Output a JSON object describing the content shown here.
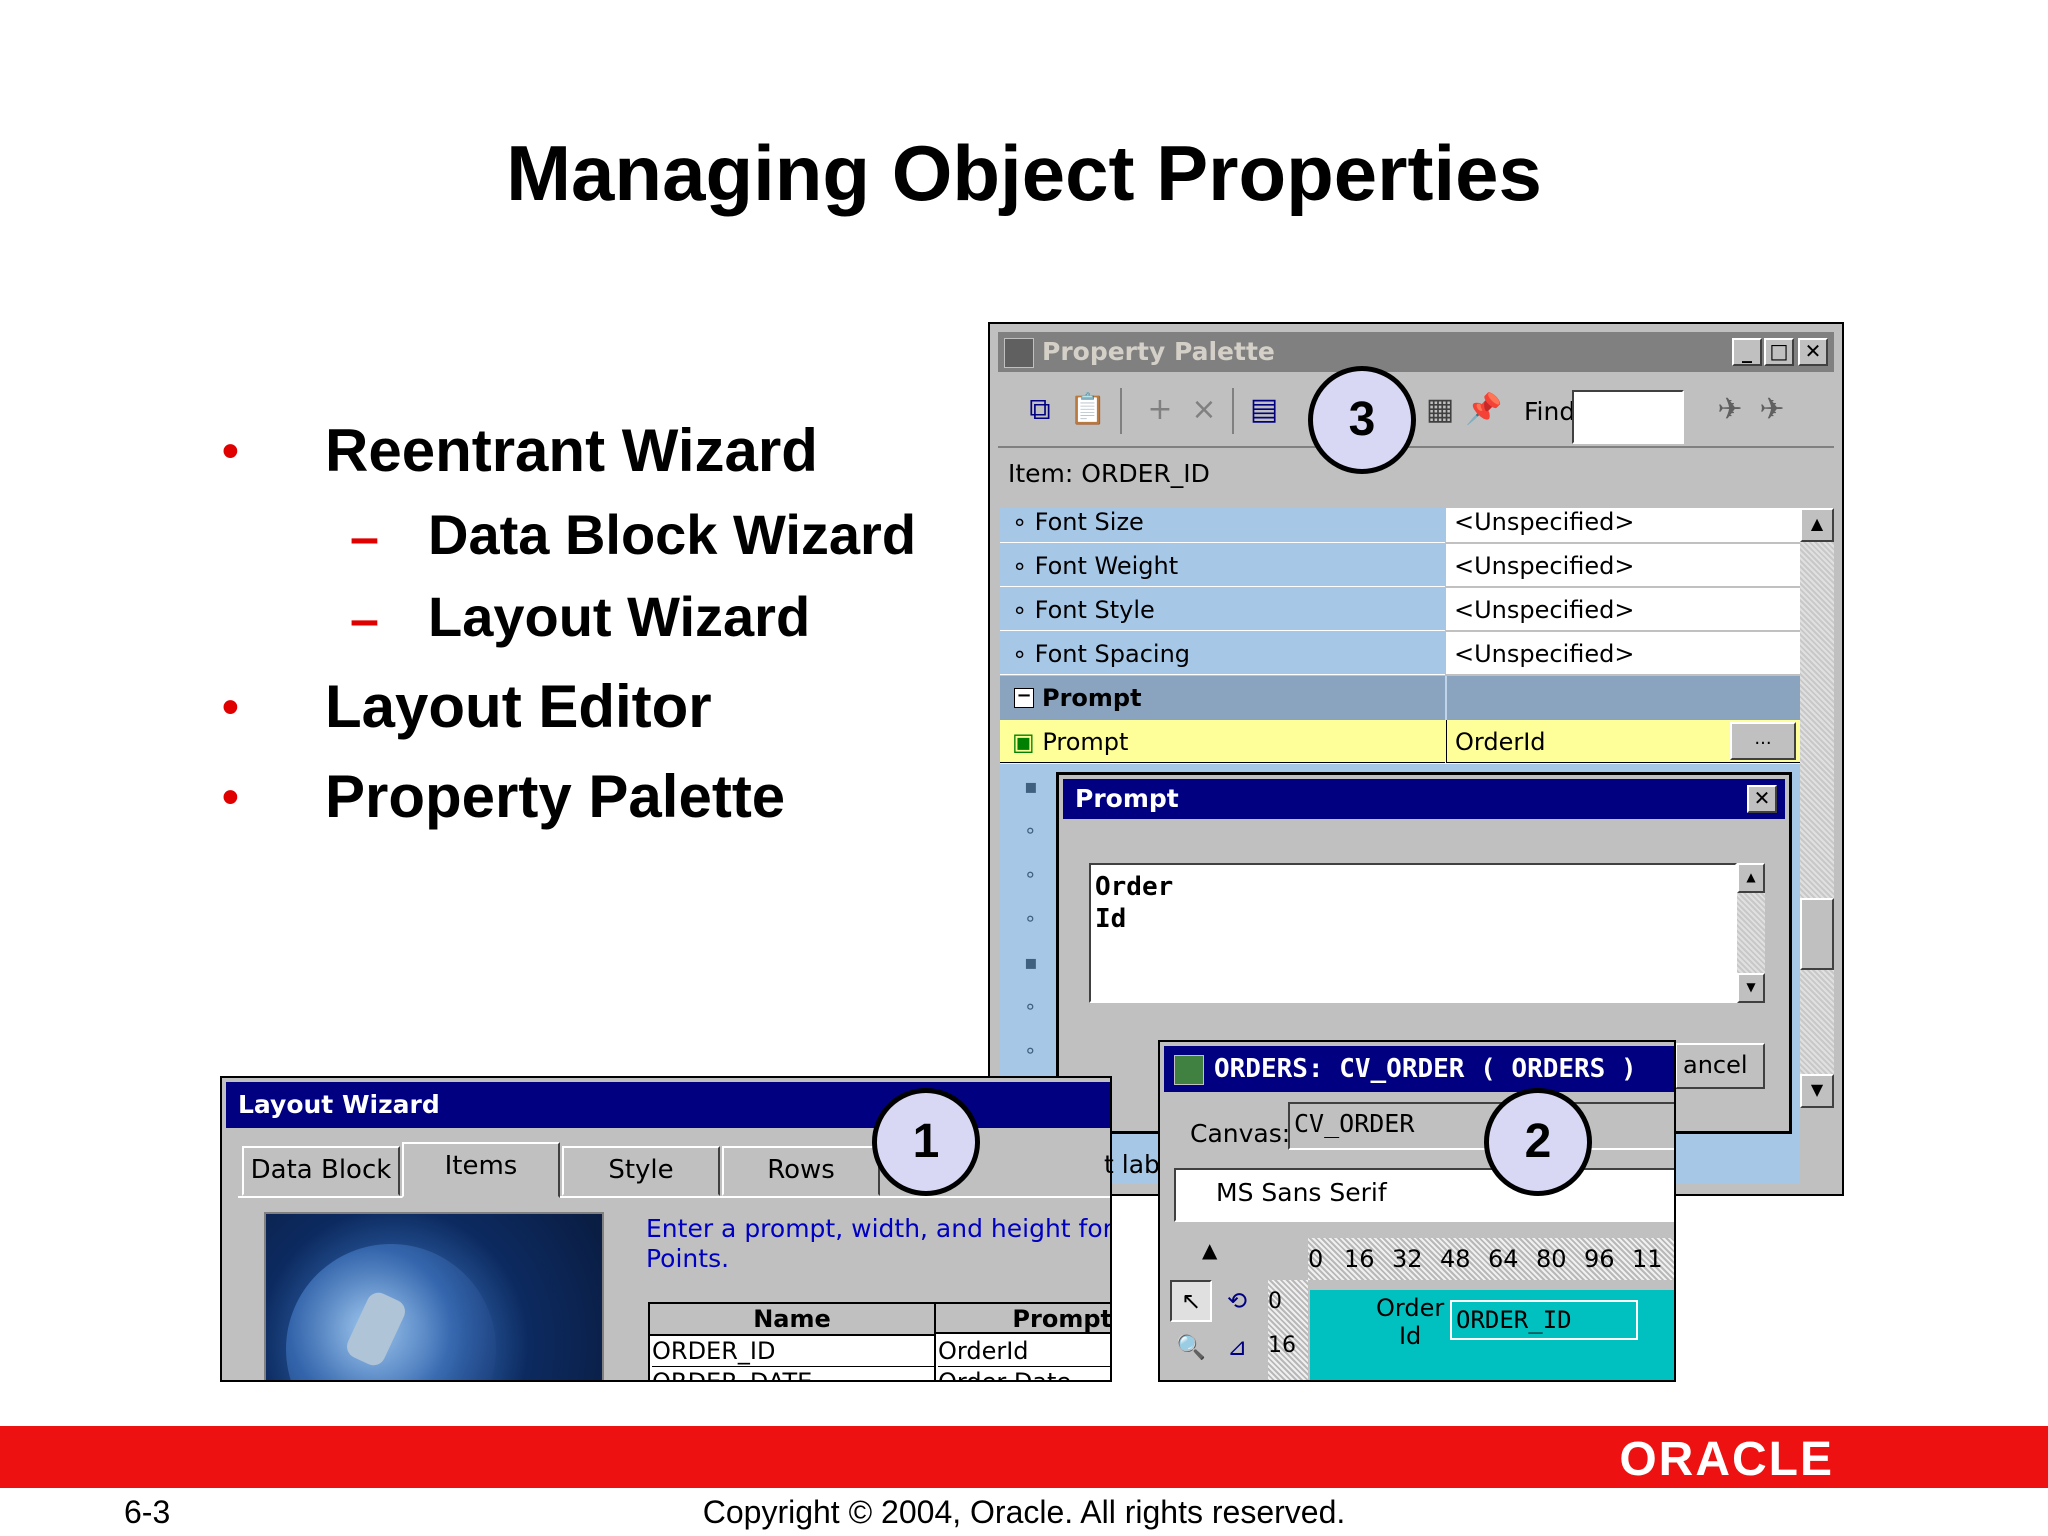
{
  "slide": {
    "title": "Managing Object Properties",
    "bullets": [
      {
        "text": "Reentrant Wizard",
        "level": 1
      },
      {
        "text": "Data Block Wizard",
        "level": 2
      },
      {
        "text": "Layout Wizard",
        "level": 2
      },
      {
        "text": "Layout Editor",
        "level": 1
      },
      {
        "text": "Property Palette",
        "level": 1
      }
    ],
    "bullet_marker": "•",
    "dash_marker": "–",
    "callouts": [
      "1",
      "2",
      "3"
    ],
    "logo": "ORACLE",
    "page_number": "6-3",
    "copyright": "Copyright © 2004, Oracle.  All rights reserved.",
    "colors": {
      "red": "#ee1111",
      "callout_fill": "#d8d8f4",
      "highlight": "#ffff99",
      "prop_blue": "#a7c7e7"
    }
  },
  "property_palette": {
    "title": "Property Palette",
    "find_label": "Find:",
    "item_label": "Item: ORDER_ID",
    "rows": [
      {
        "name": "Font Size",
        "value": "<Unspecified>"
      },
      {
        "name": "Font Weight",
        "value": "<Unspecified>"
      },
      {
        "name": "Font Style",
        "value": "<Unspecified>"
      },
      {
        "name": "Font Spacing",
        "value": "<Unspecified>"
      }
    ],
    "group": "Prompt",
    "selected_row": {
      "name": "Prompt",
      "value": "OrderId",
      "more": "..."
    }
  },
  "prompt_dialog": {
    "title": "Prompt",
    "text_line1": "Order",
    "text_line2": "Id",
    "cancel_partial": "ancel"
  },
  "layout_editor": {
    "title": "ORDERS: CV_ORDER ( ORDERS )",
    "canvas_label": "Canvas:",
    "canvas_value": "CV_ORDER",
    "font_value": "MS Sans Serif",
    "ruler": [
      "0",
      "16",
      "32",
      "48",
      "64",
      "80",
      "96",
      "11"
    ],
    "vruler": [
      "0",
      "16"
    ],
    "prompt_line1": "Order",
    "prompt_line2": "Id",
    "item_text": "ORDER_ID",
    "partial_text": "t lab"
  },
  "layout_wizard": {
    "title": "Layout Wizard",
    "tabs": [
      "Data Block",
      "Items",
      "Style",
      "Rows"
    ],
    "instruction_line1": "Enter a prompt, width, and height for each i",
    "instruction_line2": "Points.",
    "columns": [
      "Name",
      "Prompt"
    ],
    "rows": [
      {
        "name": "ORDER_ID",
        "prompt": "OrderId"
      },
      {
        "name": "ORDER_DATE",
        "prompt": "Order Date"
      }
    ]
  }
}
